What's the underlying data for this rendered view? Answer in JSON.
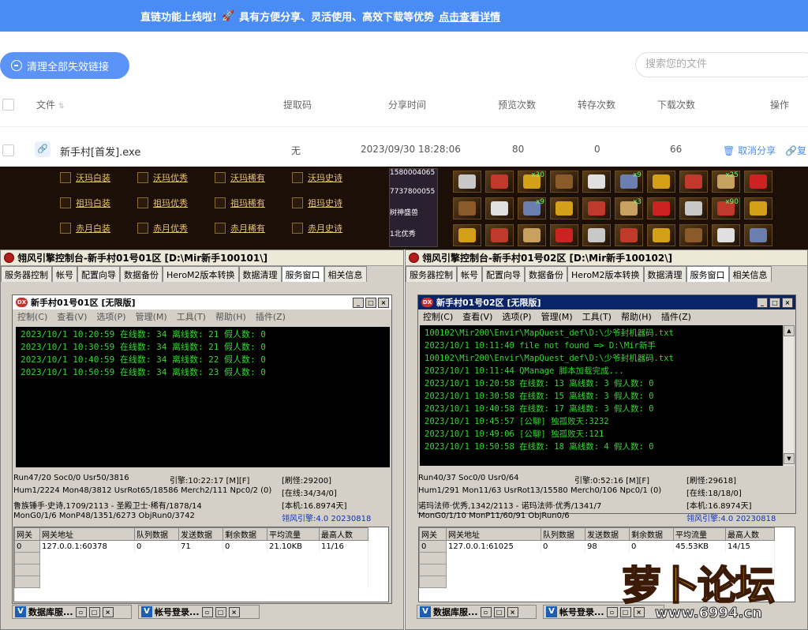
{
  "banner": {
    "text": "直链功能上线啦!",
    "sub": "具有方便分享、灵活使用、高效下载等优势",
    "link": "点击查看详情"
  },
  "toolbar": {
    "clear_label": "清理全部失效链接",
    "search_placeholder": "搜索您的文件"
  },
  "table": {
    "headers": {
      "file": "文件",
      "code": "提取码",
      "time": "分享时间",
      "preview": "预览次数",
      "forward": "转存次数",
      "download": "下载次数",
      "ops": "操作"
    },
    "rows": [
      {
        "name": "新手村[首发].exe",
        "code": "无",
        "time": "2023/09/30 18:28:06",
        "preview": "80",
        "forward": "0",
        "download": "66",
        "cancel": "取消分享",
        "copy": "复"
      }
    ]
  },
  "game": {
    "equips": [
      "沃玛白装",
      "沃玛优秀",
      "沃玛稀有",
      "沃玛史诗",
      "祖玛白装",
      "祖玛优秀",
      "祖玛稀有",
      "祖玛史诗",
      "赤月白装",
      "赤月优秀",
      "赤月稀有",
      "赤月史诗"
    ],
    "char_lines": [
      "1580004065",
      "7737800055",
      "树神盛兽",
      "1北优秀"
    ],
    "slot_counts": [
      "x30",
      "x9",
      "x25",
      "x9",
      "x3",
      "x90",
      "x2"
    ]
  },
  "win1": {
    "title": "翎风引擎控制台-新手村01号01区 [D:\\Mir新手100101\\]",
    "tabs": [
      "服务器控制",
      "帐号",
      "配置向导",
      "数据备份",
      "HeroM2版本转换",
      "数据清理",
      "服务窗口",
      "相关信息"
    ],
    "inner_title": "新手村01号01区 [无限版]",
    "menu": [
      "控制(C)",
      "查看(V)",
      "选项(P)",
      "管理(M)",
      "工具(T)",
      "帮助(H)",
      "插件(Z)"
    ],
    "log": [
      "2023/10/1 10:20:59 在线数: 34 离线数: 21 假人数: 0",
      "2023/10/1 10:30:59 在线数: 34 离线数: 21 假人数: 0",
      "2023/10/1 10:40:59 在线数: 34 离线数: 22 假人数: 0",
      "2023/10/1 10:50:59 在线数: 34 离线数: 23 假人数: 0"
    ],
    "stat": [
      "Run47/20 Soc0/0 Usr50/3816",
      "引擎:10:22:17 [M][F]",
      "[刷怪:29200]",
      "Hum1/2224 Mon48/3812 UsrRot65/18586 Merch2/111 Npc0/2 (0)",
      "[在线:34/34/0]",
      "鲁族锤手·史诗,1709/2113 - 圣殿卫士·稀有/1878/14",
      "[本机:16.8974天]",
      "MonG0/1/6 MonP48/1351/6273 ObjRun0/3742",
      "翎风引擎:4.0 20230818"
    ],
    "grid_headers": [
      "网关",
      "网关地址",
      "队列数据",
      "发送数据",
      "剩余数据",
      "平均流量",
      "最高人数"
    ],
    "grid_row": [
      "0",
      "127.0.0.1:60378",
      "0",
      "71",
      "0",
      "21.10KB",
      "11/16"
    ],
    "task": [
      "数据库服...",
      "帐号登录..."
    ]
  },
  "win2": {
    "title": "翎风引擎控制台-新手村01号02区 [D:\\Mir新手100102\\]",
    "tabs": [
      "服务器控制",
      "帐号",
      "配置向导",
      "数据备份",
      "HeroM2版本转换",
      "数据清理",
      "服务窗口",
      "相关信息"
    ],
    "inner_title": "新手村01号02区 [无限版]",
    "menu": [
      "控制(C)",
      "查看(V)",
      "选项(P)",
      "管理(M)",
      "工具(T)",
      "帮助(H)",
      "插件(Z)"
    ],
    "log": [
      "100102\\Mir200\\Envir\\MapQuest_def\\D:\\少爷封机器码.txt",
      "2023/10/1 10:11:40 file not found => D:\\Mir新手",
      "100102\\Mir200\\Envir\\MapQuest_def\\D:\\少爷封机器码.txt",
      "2023/10/1 10:11:44 QManage 脚本加载完成...",
      "2023/10/1 10:20:58 在线数: 13 离线数: 3 假人数: 0",
      "2023/10/1 10:30:58 在线数: 15 离线数: 3 假人数: 0",
      "2023/10/1 10:40:58 在线数: 17 离线数: 3 假人数: 0",
      "2023/10/1 10:45:57 [公聊] 独孤败天:3232",
      "2023/10/1 10:49:06 [公聊] 独孤败天:121",
      "2023/10/1 10:50:58 在线数: 18 离线数: 4 假人数: 0"
    ],
    "stat": [
      "Run40/37 Soc0/0 Usr0/64",
      "引擎:0:52:16 [M][F]",
      "[刷怪:29618]",
      "Hum1/291 Mon11/63 UsrRot13/15580 Merch0/106 Npc0/1 (0)",
      "[在线:18/18/0]",
      "诺玛法师·优秀,1342/2113 - 诺玛法师·优秀/1341/7",
      "[本机:16.8974天]",
      "MonG0/1/10 MonP11/60/91 ObjRun0/6",
      "翎风引擎:4.0 20230818"
    ],
    "grid_headers": [
      "网关",
      "网关地址",
      "队列数据",
      "发送数据",
      "剩余数据",
      "平均流量",
      "最高人数"
    ],
    "grid_row": [
      "0",
      "127.0.0.1:61025",
      "0",
      "98",
      "0",
      "45.53KB",
      "14/15"
    ],
    "task": [
      "数据库服...",
      "帐号登录..."
    ]
  },
  "watermark": {
    "text": "萝卜论坛",
    "url": "www.6994.cn"
  }
}
